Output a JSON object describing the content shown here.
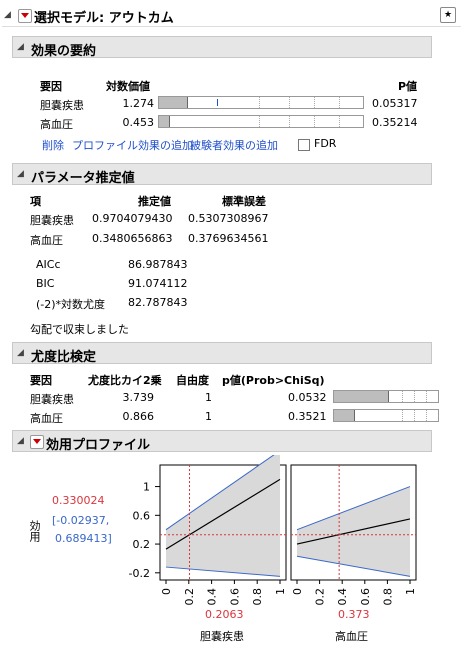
{
  "title": "選択モデル: アウトカム",
  "effects": {
    "title": "効果の要約",
    "col_source": "要因",
    "col_logworth": "対数価値",
    "col_p": "P値",
    "rows": [
      {
        "name": "胆嚢疾患",
        "logworth": "1.274",
        "p": "0.05317",
        "value": 1.274
      },
      {
        "name": "高血圧",
        "logworth": "0.453",
        "p": "0.35214",
        "value": 0.453
      }
    ],
    "actions": [
      "削除",
      "プロファイル効果の追加",
      "被験者効果の追加"
    ],
    "fdr_label": "FDR"
  },
  "params": {
    "title": "パラメータ推定値",
    "col_term": "項",
    "col_est": "推定値",
    "col_se": "標準誤差",
    "rows": [
      {
        "name": "胆嚢疾患",
        "est": "0.9704079430",
        "se": "0.5307308967"
      },
      {
        "name": "高血圧",
        "est": "0.3480656863",
        "se": "0.3769634561"
      }
    ],
    "fit": [
      {
        "label": "AICc",
        "value": "86.987843"
      },
      {
        "label": "BIC",
        "value": "91.074112"
      },
      {
        "label": "(-2)*対数尤度",
        "value": "82.787843"
      }
    ],
    "converge": "勾配で収束しました"
  },
  "lrt": {
    "title": "尤度比検定",
    "col_source": "要因",
    "col_chi": "尤度比カイ2乗",
    "col_df": "自由度",
    "col_p": "p値(Prob>ChiSq)",
    "rows": [
      {
        "name": "胆嚢疾患",
        "chi": "3.739",
        "df": "1",
        "p": "0.0532",
        "value": 3.739
      },
      {
        "name": "高血圧",
        "chi": "0.866",
        "df": "1",
        "p": "0.3521",
        "value": 0.866
      }
    ]
  },
  "profiler": {
    "title": "効用プロファイル",
    "ylabel": "効用",
    "current_value": "0.330024",
    "ci": "[-0.02937,",
    "ci2": "0.689413]",
    "yticks": [
      "1",
      "0.6",
      "0.2",
      "-0.2"
    ],
    "xticks": [
      "0",
      "0.2",
      "0.4",
      "0.6",
      "0.8",
      "1"
    ],
    "factors": [
      {
        "name": "胆嚢疾患",
        "current": "0.2063",
        "x": 0.2063
      },
      {
        "name": "高血圧",
        "current": "0.373",
        "x": 0.373
      }
    ]
  },
  "colors": {
    "accent_red": "#d9363e",
    "ci_blue": "#3a68c8",
    "band": "#d9d9d9"
  },
  "chart_data": {
    "type": "line",
    "ylabel": "効用",
    "ylim": [
      -0.3,
      1.3
    ],
    "xlim": [
      0,
      1
    ],
    "current_y": 0.330024,
    "series": [
      {
        "name": "胆嚢疾患",
        "x": [
          0,
          1
        ],
        "y": [
          0.13,
          1.1
        ],
        "lower": [
          -0.12,
          -0.25
        ],
        "upper": [
          0.4,
          1.5
        ]
      },
      {
        "name": "高血圧",
        "x": [
          0,
          1
        ],
        "y": [
          0.2,
          0.55
        ],
        "lower": [
          0.03,
          -0.25
        ],
        "upper": [
          0.4,
          1.0
        ]
      }
    ]
  }
}
